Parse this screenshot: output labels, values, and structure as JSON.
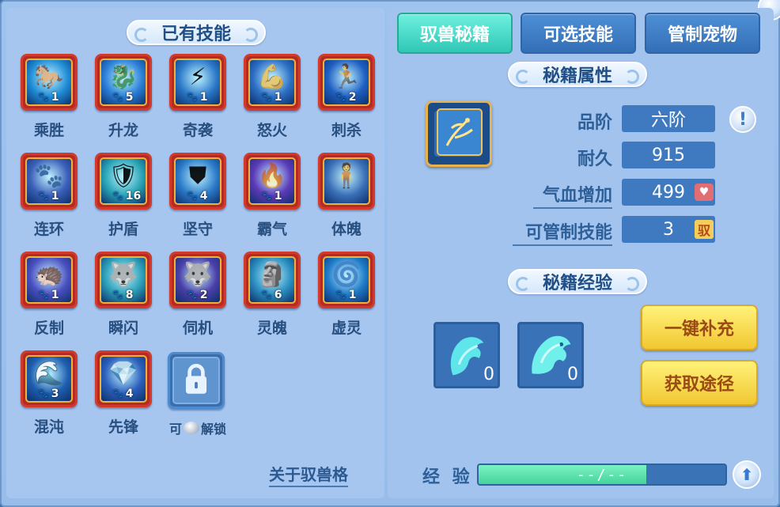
{
  "left": {
    "title": "已有技能",
    "skills": [
      {
        "name": "乘胜",
        "level": "1",
        "color": "#1f8cd6"
      },
      {
        "name": "升龙",
        "level": "5",
        "color": "#2a7fd8"
      },
      {
        "name": "奇袭",
        "level": "1",
        "color": "#2a78c8"
      },
      {
        "name": "怒火",
        "level": "1",
        "color": "#2b6fc4"
      },
      {
        "name": "刺杀",
        "level": "2",
        "color": "#1e5fc2"
      },
      {
        "name": "连环",
        "level": "1",
        "color": "#3a5fb8"
      },
      {
        "name": "护盾",
        "level": "16",
        "color": "#27a3b5"
      },
      {
        "name": "坚守",
        "level": "4",
        "color": "#2b7bc9"
      },
      {
        "name": "霸气",
        "level": "1",
        "color": "#5c3ab8"
      },
      {
        "name": "体魄",
        "level": "",
        "color": "#3a6fb8"
      },
      {
        "name": "反制",
        "level": "1",
        "color": "#4a4fc0"
      },
      {
        "name": "瞬闪",
        "level": "8",
        "color": "#2c9fb8"
      },
      {
        "name": "伺机",
        "level": "2",
        "color": "#4a3fa8"
      },
      {
        "name": "灵魄",
        "level": "6",
        "color": "#2b8fc0"
      },
      {
        "name": "虚灵",
        "level": "1",
        "color": "#1f7bc8"
      },
      {
        "name": "混沌",
        "level": "3",
        "color": "#1f5fb0"
      },
      {
        "name": "先锋",
        "level": "4",
        "color": "#2b5fbb"
      }
    ],
    "locked_slot": {
      "prefix": "可",
      "suffix": "解锁"
    },
    "about_link": "关于驭兽格"
  },
  "tabs": [
    {
      "label": "驭兽秘籍",
      "active": true
    },
    {
      "label": "可选技能",
      "active": false
    },
    {
      "label": "管制宠物",
      "active": false
    }
  ],
  "attributes": {
    "title": "秘籍属性",
    "grade_label": "品阶",
    "grade_value": "六阶",
    "durability_label": "耐久",
    "durability_value": "915",
    "hp_label": "气血增加",
    "hp_value": "499",
    "control_label": "可管制技能",
    "control_value": "3",
    "control_badge": "驭",
    "info_icon": "!"
  },
  "experience": {
    "title": "秘籍经验",
    "items": [
      {
        "count": "0"
      },
      {
        "count": "0"
      }
    ],
    "fill_button": "一键补充",
    "source_button": "获取途径",
    "bar_label": "经 验",
    "bar_text": "--/--",
    "bar_fill_fraction": 0.68
  }
}
